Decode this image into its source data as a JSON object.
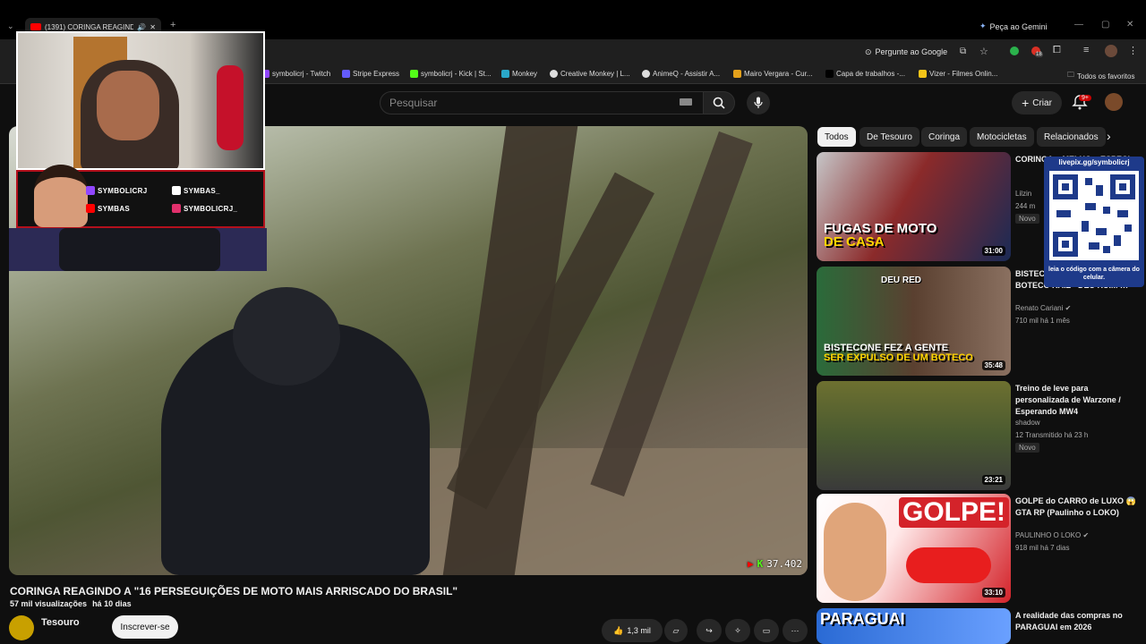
{
  "browser": {
    "tab_title": "(1391) CORINGA REAGINDO",
    "gemini_label": "Peça ao Gemini",
    "google_prompt": "Pergunte ao Google",
    "bookmarks": [
      "symbolicrj - Twitch",
      "Stripe Express",
      "symbolicrj - Kick | St...",
      "Monkey",
      "Creative Monkey | L...",
      "AnimeQ - Assistir A...",
      "Mairo Vergara - Cur...",
      "Capa de trabalhos -...",
      "Vizer - Filmes Onlin..."
    ],
    "all_bookmarks": "Todos os favoritos",
    "ext_badge": "18"
  },
  "youtube": {
    "search_placeholder": "Pesquisar",
    "create_label": "Criar",
    "notif_count": "9+"
  },
  "stream_overlay": {
    "socials": [
      {
        "platform": "twitch-icon",
        "handle": "SYMBOLICRJ"
      },
      {
        "platform": "tiktok-icon",
        "handle": "SYMBAS_"
      },
      {
        "platform": "youtube-icon",
        "handle": "SYMBAS"
      },
      {
        "platform": "instagram-icon",
        "handle": "SYMBOLICRJ_"
      }
    ],
    "viewer_count": "37.402",
    "qr_url": "livepix.gg/symbolicrj",
    "qr_caption": "leia o código com a câmera do celular."
  },
  "video": {
    "title": "CORINGA REAGINDO A \"16 PERSEGUIÇÕES DE MOTO MAIS ARRISCADO DO BRASIL\"",
    "views": "57 mil visualizações",
    "age": "há 10 dias",
    "channel": "Tesouro",
    "subscribe_label": "Inscrever-se",
    "likes": "1,3 mil"
  },
  "chips": [
    "Todos",
    "De Tesouro",
    "Coringa",
    "Motocicletas",
    "Relacionados"
  ],
  "recommendations": [
    {
      "title": "CORINGA... MELHO... ESPECI...",
      "thumb_text_1": "FUGAS DE MOTO",
      "thumb_text_2": "DE CASA",
      "channel": "Lilzin",
      "meta": "244 m",
      "badge": "Novo",
      "duration": "31:00"
    },
    {
      "title": "BISTECONE... SER EX... BOTECO RAIZ - DEU RUIM !!!",
      "thumb_text_1": "BISTECONE FEZ A GENTE",
      "thumb_text_2": "SER EXPULSO DE UM BOTECO",
      "thumb_tag": "DEU RED",
      "channel": "Renato Cariani",
      "meta": "710 mil  há 1 mês",
      "badge": "",
      "duration": "35:48"
    },
    {
      "title": "Treino de leve para personalizada de Warzone / Esperando MW4",
      "thumb_text_1": "",
      "thumb_text_2": "",
      "channel": "shadow",
      "meta": "12  Transmitido há 23 h",
      "badge": "Novo",
      "duration": "23:21"
    },
    {
      "title": "GOLPE do CARRO de LUXO 😱 GTA RP (Paulinho o LOKO)",
      "thumb_text_1": "GOLPE!",
      "thumb_text_2": "",
      "channel": "PAULINHO O LOKO",
      "meta": "918 mil  há 7 dias",
      "badge": "",
      "duration": "33:10"
    },
    {
      "title": "A realidade das compras no PARAGUAI em 2026",
      "thumb_text_1": "PARAGUAI",
      "thumb_text_2": "",
      "channel": "",
      "meta": "",
      "badge": "",
      "duration": ""
    }
  ],
  "colors": {
    "yt_red": "#ff0000",
    "kick_green": "#53fc18",
    "bg": "#0f0f0f"
  }
}
